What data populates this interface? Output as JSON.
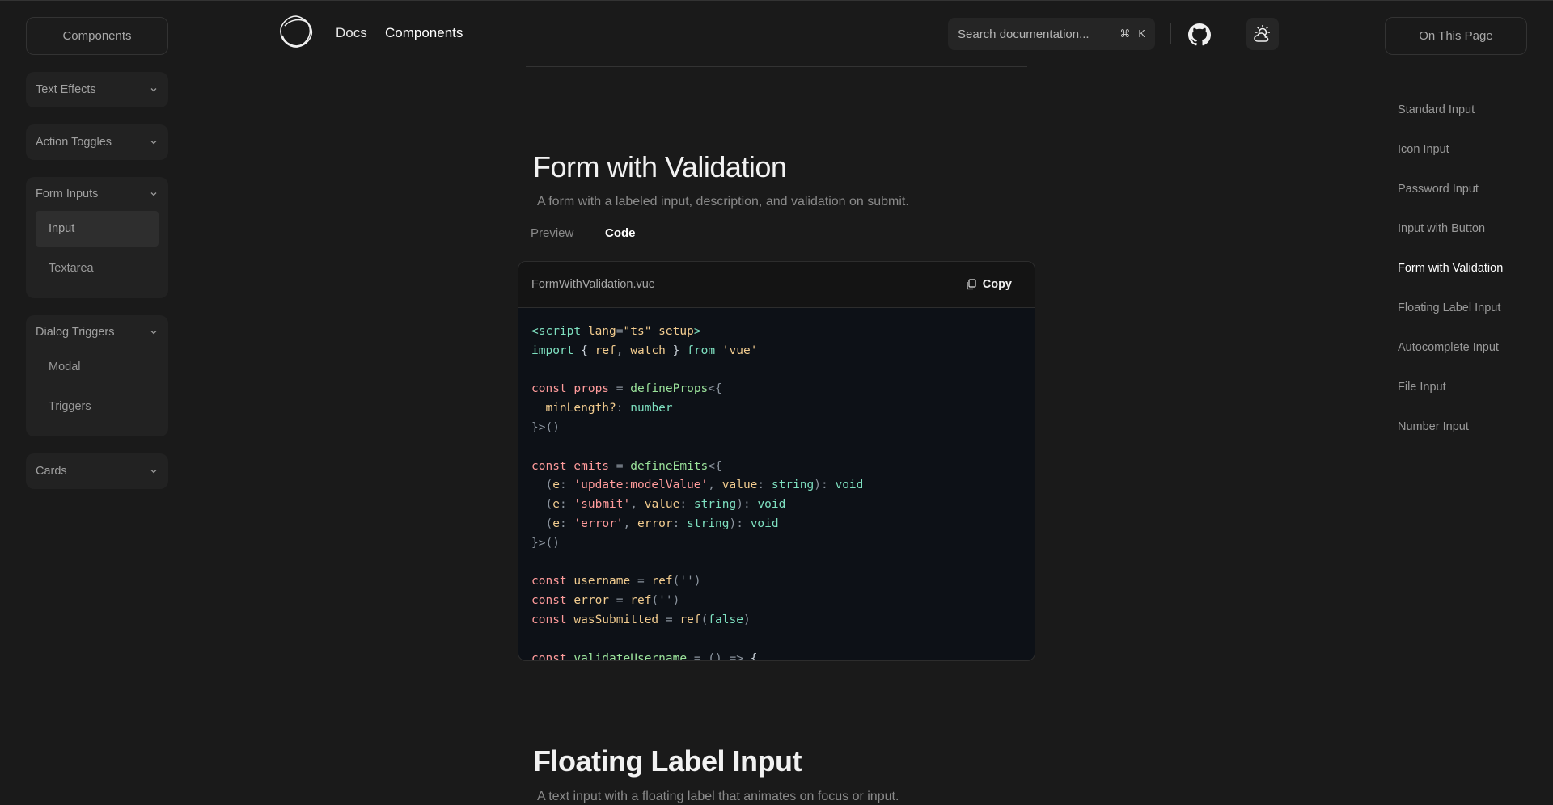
{
  "left_sidebar": {
    "title": "Components",
    "groups": [
      {
        "label": "Text Effects",
        "items": []
      },
      {
        "label": "Action Toggles",
        "items": []
      },
      {
        "label": "Form Inputs",
        "items": [
          {
            "label": "Input"
          },
          {
            "label": "Textarea"
          }
        ]
      },
      {
        "label": "Dialog Triggers",
        "items": [
          {
            "label": "Modal"
          },
          {
            "label": "Triggers"
          }
        ]
      },
      {
        "label": "Cards",
        "items": []
      }
    ],
    "active_item": "Input"
  },
  "header": {
    "nav": {
      "docs": "Docs",
      "components": "Components"
    },
    "search": {
      "placeholder": "Search documentation...",
      "shortcut_mod": "⌘",
      "shortcut_key": "K"
    },
    "icons": {
      "logo": "logo-icon",
      "github": "github-icon",
      "theme": "theme-toggle-icon"
    }
  },
  "main": {
    "section": {
      "title": "Form with Validation",
      "description": "A form with a labeled input, description, and validation on submit.",
      "tabs": {
        "preview": "Preview",
        "code": "Code"
      },
      "active_tab": "Code",
      "code": {
        "file_name": "FormWithValidation.vue",
        "copy_label": "Copy"
      }
    },
    "next_section": {
      "title": "Floating Label Input",
      "description": "A text input with a floating label that animates on focus or input."
    }
  },
  "right_sidebar": {
    "title": "On This Page",
    "items": [
      {
        "label": "Standard Input"
      },
      {
        "label": "Icon Input"
      },
      {
        "label": "Password Input"
      },
      {
        "label": "Input with Button"
      },
      {
        "label": "Form with Validation"
      },
      {
        "label": "Floating Label Input"
      },
      {
        "label": "Autocomplete Input"
      },
      {
        "label": "File Input"
      },
      {
        "label": "Number Input"
      }
    ],
    "active_item": "Form with Validation"
  },
  "colors": {
    "background": "#1a1a1a",
    "code_background": "#0d1117",
    "keyword": "#ff9b9b",
    "string": "#f2cc8f",
    "function": "#9be39b",
    "type": "#7ee0c0"
  }
}
